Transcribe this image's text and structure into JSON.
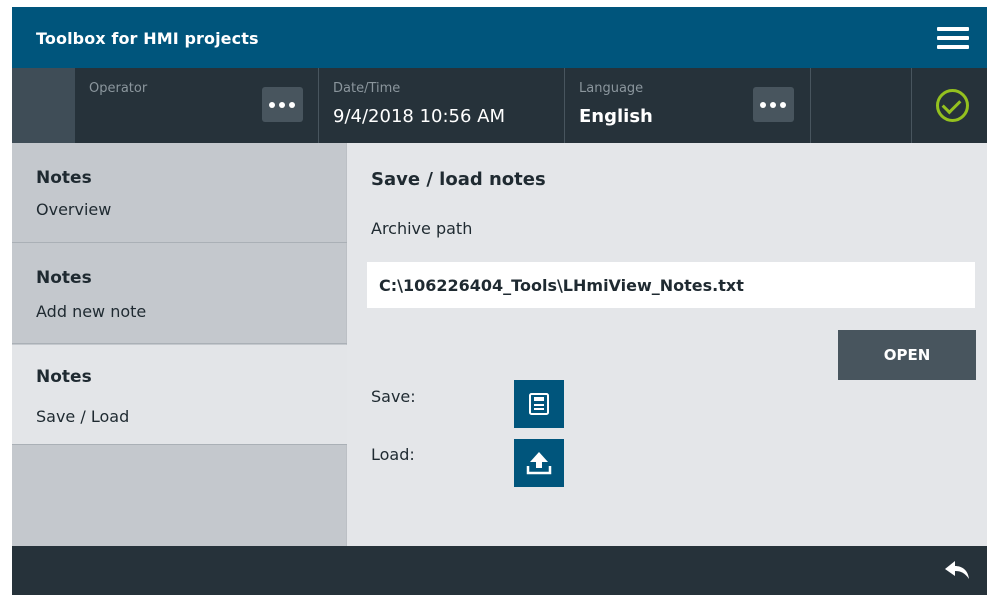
{
  "app": {
    "title": "Toolbox for HMI projects"
  },
  "header": {
    "menu_icon": "hamburger-menu-icon"
  },
  "status": {
    "operator_label": "Operator",
    "operator_value": "",
    "datetime_label": "Date/Time",
    "datetime_value": "9/4/2018 10:56 AM",
    "language_label": "Language",
    "language_value": "English",
    "status_icon": "check-circle-icon",
    "status_color": "#94c11f"
  },
  "sidebar": {
    "items": [
      {
        "title": "Notes",
        "subtitle": "Overview",
        "active": false
      },
      {
        "title": "Notes",
        "subtitle": "Add new note",
        "active": false
      },
      {
        "title": "Notes",
        "subtitle": "Save / Load",
        "active": true
      }
    ]
  },
  "main": {
    "title": "Save / load notes",
    "archive_path_label": "Archive path",
    "archive_path_value": "C:\\106226404_Tools\\LHmiView_Notes.txt",
    "open_button": "OPEN",
    "save_label": "Save:",
    "save_icon": "floppy-disk-icon",
    "load_label": "Load:",
    "load_icon": "upload-icon"
  },
  "footer": {
    "back_icon": "reply-arrow-icon"
  },
  "colors": {
    "brand": "#00557c",
    "dark_bar": "#26323a",
    "button": "#48555e",
    "ok": "#94c11f"
  }
}
